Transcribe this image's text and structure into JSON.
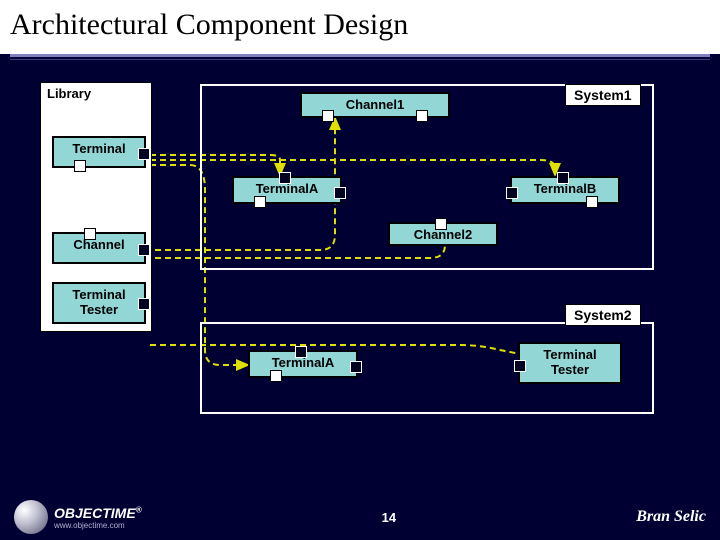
{
  "title": "Architectural Component Design",
  "library": {
    "label": "Library",
    "terminal": "Terminal",
    "channel": "Channel",
    "tester": "Terminal\nTester"
  },
  "system1": {
    "label": "System1",
    "channel1": "Channel1",
    "terminalA": "TerminalA",
    "terminalB": "TerminalB",
    "channel2": "Channel2"
  },
  "system2": {
    "label": "System2",
    "terminalA": "TerminalA",
    "tester": "Terminal\nTester"
  },
  "footer": {
    "logo": "OBJECTIME",
    "url": "www.objectime.com",
    "page": "14",
    "author": "Bran Selic"
  }
}
